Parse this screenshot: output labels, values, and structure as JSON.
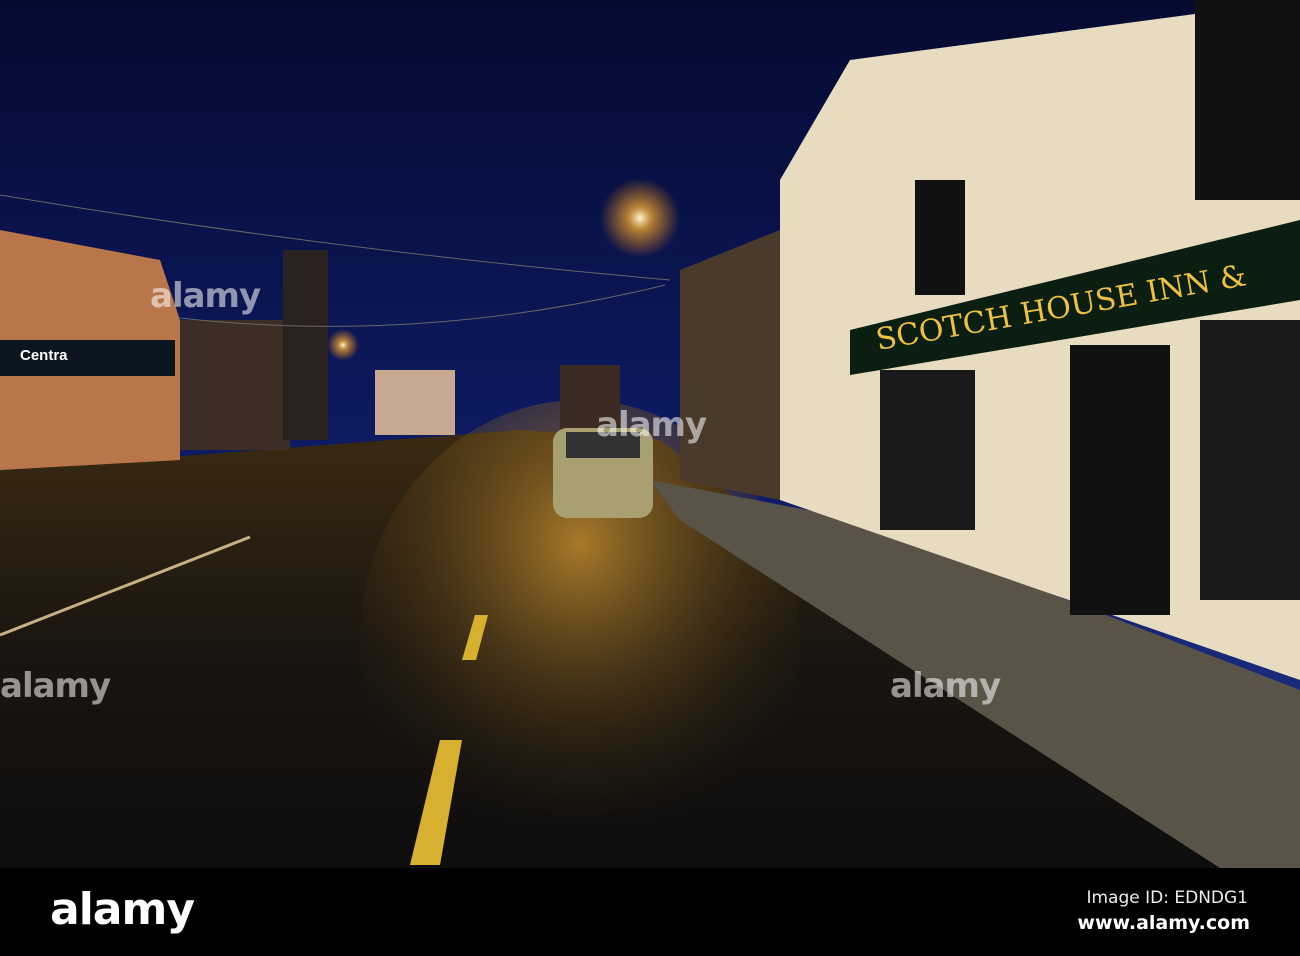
{
  "photo": {
    "shop_sign_left": "Centra",
    "pub_sign": "SCOTCH HOUSE INN &",
    "watermark": "alamy"
  },
  "footer": {
    "logo": "alamy",
    "image_id": "Image ID: EDNDG1",
    "website": "www.alamy.com"
  }
}
